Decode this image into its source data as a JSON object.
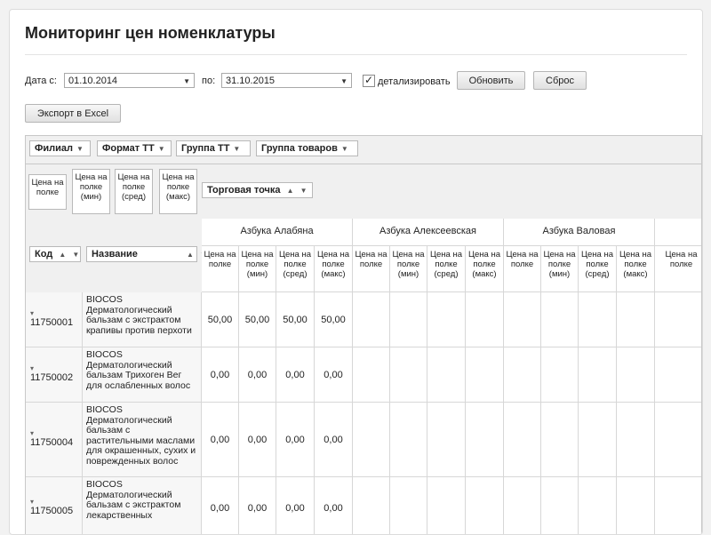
{
  "title": "Мониторинг цен номенклатуры",
  "filters": {
    "date_from_label": "Дата с:",
    "date_from": "01.10.2014",
    "date_to_label": "по:",
    "date_to": "31.10.2015",
    "detail_checked": "✓",
    "detail_label": "детализировать",
    "refresh_label": "Обновить",
    "reset_label": "Сброс",
    "export_label": "Экспорт в Excel"
  },
  "pivot": {
    "filter_fields": [
      "Филиал",
      "Формат ТТ",
      "Группа ТТ",
      "Группа товаров"
    ],
    "measures": [
      "Цена на полке",
      "Цена на полке (мин)",
      "Цена на полке (сред)",
      "Цена на полке (макс)"
    ],
    "column_field": "Торговая точка",
    "row_fields": [
      "Код",
      "Название"
    ],
    "filter_icon": "funnel-icon",
    "sort_icon": "sort-up-icon",
    "expand_icon": "collapse-arrow-icon",
    "stores": [
      "Азбука Алабяна",
      "Азбука Алексеевская",
      "Азбука Валовая"
    ],
    "partial_measure": "Цена на полке",
    "rows": [
      {
        "code": "11750001",
        "name": "BIOCOS Дерматологический бальзам с экстрактом крапивы против перхоти",
        "values": [
          "50,00",
          "50,00",
          "50,00",
          "50,00"
        ]
      },
      {
        "code": "11750002",
        "name": "BIOCOS Дерматологический бальзам Трихоген Вег для ослабленных волос",
        "values": [
          "0,00",
          "0,00",
          "0,00",
          "0,00"
        ]
      },
      {
        "code": "11750004",
        "name": "BIOCOS Дерматологический бальзам с растительными маслами для окрашенных, сухих и поврежденных волос",
        "values": [
          "0,00",
          "0,00",
          "0,00",
          "0,00"
        ]
      },
      {
        "code": "11750005",
        "name": "BIOCOS Дерматологический бальзам с экстрактом лекарственных",
        "values": [
          "0,00",
          "0,00",
          "0,00",
          "0,00"
        ]
      }
    ]
  }
}
